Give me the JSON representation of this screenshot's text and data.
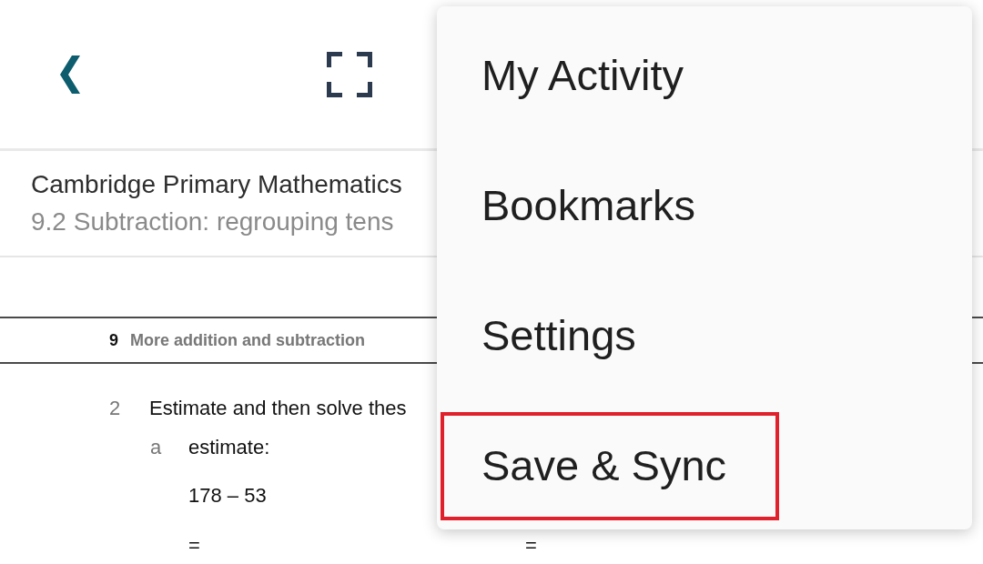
{
  "header": {
    "title": "Cambridge Primary Mathematics",
    "subtitle": "9.2 Subtraction: regrouping tens"
  },
  "page": {
    "running_header": {
      "chapter_number": "9",
      "chapter_title": "More addition and subtraction"
    },
    "question": {
      "number": "2",
      "text": "Estimate and then solve thes",
      "part": {
        "label": "a",
        "prompt": "estimate:",
        "expression": "178 – 53"
      },
      "answer_marks": [
        "=",
        "="
      ]
    }
  },
  "menu": {
    "items": [
      {
        "label": "My Activity",
        "highlighted": false
      },
      {
        "label": "Bookmarks",
        "highlighted": false
      },
      {
        "label": "Settings",
        "highlighted": false
      },
      {
        "label": "Save & Sync",
        "highlighted": true
      }
    ]
  }
}
